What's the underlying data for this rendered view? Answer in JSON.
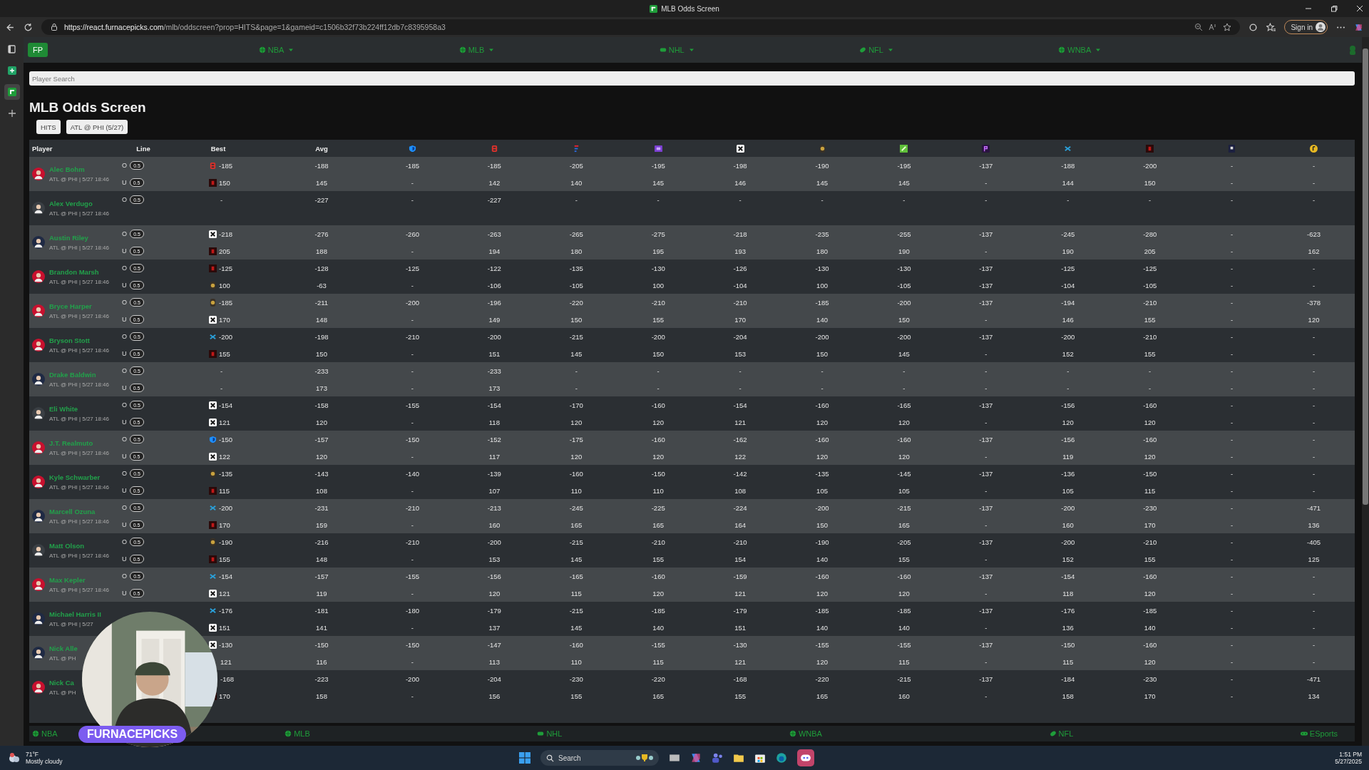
{
  "browser": {
    "tab_title": "MLB Odds Screen",
    "url_host": "https://react.furnacepicks.com",
    "url_path": "/mlb/oddscreen?prop=HITS&page=1&gameid=c1506b32f73b224ff12db7c8395958a3",
    "sign_in": "Sign in"
  },
  "sidebar": {
    "apps": [
      {
        "kind": "tabs",
        "selected": false
      },
      {
        "kind": "sheet",
        "selected": false
      },
      {
        "kind": "fp",
        "selected": true
      },
      {
        "kind": "add",
        "selected": false
      }
    ]
  },
  "nav": {
    "logo": "FP",
    "leagues": [
      {
        "label": "NBA",
        "kind": "ball"
      },
      {
        "label": "MLB",
        "kind": "ball"
      },
      {
        "label": "NHL",
        "kind": "puck"
      },
      {
        "label": "NFL",
        "kind": "football"
      },
      {
        "label": "WNBA",
        "kind": "ball"
      }
    ]
  },
  "search": {
    "placeholder": "Player Search"
  },
  "title": "MLB Odds Screen",
  "filters": [
    "HITS",
    "ATL @ PHI (5/27)"
  ],
  "table": {
    "columns": [
      "Player",
      "Line",
      "Best",
      "Avg"
    ],
    "books": [
      {
        "kind": "shield"
      },
      {
        "kind": "b"
      },
      {
        "kind": "f"
      },
      {
        "kind": "purple"
      },
      {
        "kind": "n"
      },
      {
        "kind": "lion"
      },
      {
        "kind": "green"
      },
      {
        "kind": "p"
      },
      {
        "kind": "x"
      },
      {
        "kind": "red"
      },
      {
        "kind": "pdark"
      },
      {
        "kind": "gold"
      }
    ],
    "rows": [
      {
        "name": "Alec Bohm",
        "game": "ATL @ PHI | 5/27 18:46",
        "color": "#c8102e",
        "lines": [
          {
            "side": "O",
            "line": "0.5",
            "best_icon": {
              "kind": "b"
            },
            "best": "-185",
            "avg": "-188",
            "books": [
              "-185",
              "-185",
              "-205",
              "-195",
              "-198",
              "-190",
              "-195",
              "-137",
              "-188",
              "-200",
              "-",
              "-"
            ]
          },
          {
            "side": "U",
            "line": "0.5",
            "best_icon": {
              "kind": "red"
            },
            "best": "150",
            "avg": "145",
            "books": [
              "-",
              "142",
              "140",
              "145",
              "146",
              "145",
              "145",
              "-",
              "144",
              "150",
              "-",
              "-"
            ]
          }
        ]
      },
      {
        "name": "Alex Verdugo",
        "game": "ATL @ PHI | 5/27 18:46",
        "color": "#3a3f44",
        "lines": [
          {
            "side": "O",
            "line": "0.5",
            "best": "-",
            "avg": "-227",
            "books": [
              "-",
              "-227",
              "-",
              "-",
              "-",
              "-",
              "-",
              "-",
              "-",
              "-",
              "-",
              "-"
            ]
          }
        ]
      },
      {
        "name": "Austin Riley",
        "game": "ATL @ PHI | 5/27 18:46",
        "color": "#1f2a44",
        "lines": [
          {
            "side": "O",
            "line": "0.5",
            "best_icon": {
              "kind": "n"
            },
            "best": "-218",
            "avg": "-276",
            "books": [
              "-260",
              "-263",
              "-265",
              "-275",
              "-218",
              "-235",
              "-255",
              "-137",
              "-245",
              "-280",
              "-",
              "-623"
            ]
          },
          {
            "side": "U",
            "line": "0.5",
            "best_icon": {
              "kind": "red"
            },
            "best": "205",
            "avg": "188",
            "books": [
              "-",
              "194",
              "180",
              "195",
              "193",
              "180",
              "190",
              "-",
              "190",
              "205",
              "-",
              "162"
            ]
          }
        ]
      },
      {
        "name": "Brandon Marsh",
        "game": "ATL @ PHI | 5/27 18:46",
        "color": "#c8102e",
        "lines": [
          {
            "side": "O",
            "line": "0.5",
            "best_icon": {
              "kind": "red"
            },
            "best": "-125",
            "avg": "-128",
            "books": [
              "-125",
              "-122",
              "-135",
              "-130",
              "-126",
              "-130",
              "-130",
              "-137",
              "-125",
              "-125",
              "-",
              "-"
            ]
          },
          {
            "side": "U",
            "line": "0.5",
            "best_icon": {
              "kind": "lion"
            },
            "best": "100",
            "avg": "-63",
            "books": [
              "-",
              "-106",
              "-105",
              "100",
              "-104",
              "100",
              "-105",
              "-137",
              "-104",
              "-105",
              "-",
              "-"
            ]
          }
        ]
      },
      {
        "name": "Bryce Harper",
        "game": "ATL @ PHI | 5/27 18:46",
        "color": "#c8102e",
        "lines": [
          {
            "side": "O",
            "line": "0.5",
            "best_icon": {
              "kind": "lion"
            },
            "best": "-185",
            "avg": "-211",
            "books": [
              "-200",
              "-196",
              "-220",
              "-210",
              "-210",
              "-185",
              "-200",
              "-137",
              "-194",
              "-210",
              "-",
              "-378"
            ]
          },
          {
            "side": "U",
            "line": "0.5",
            "best_icon": {
              "kind": "n"
            },
            "best": "170",
            "avg": "148",
            "books": [
              "-",
              "149",
              "150",
              "155",
              "170",
              "140",
              "150",
              "-",
              "146",
              "155",
              "-",
              "120"
            ]
          }
        ]
      },
      {
        "name": "Bryson Stott",
        "game": "ATL @ PHI | 5/27 18:46",
        "color": "#c8102e",
        "lines": [
          {
            "side": "O",
            "line": "0.5",
            "best_icon": {
              "kind": "x"
            },
            "best": "-200",
            "avg": "-198",
            "books": [
              "-210",
              "-200",
              "-215",
              "-200",
              "-204",
              "-200",
              "-200",
              "-137",
              "-200",
              "-210",
              "-",
              "-"
            ]
          },
          {
            "side": "U",
            "line": "0.5",
            "best_icon": {
              "kind": "red"
            },
            "best": "155",
            "avg": "150",
            "books": [
              "-",
              "151",
              "145",
              "150",
              "153",
              "150",
              "145",
              "-",
              "152",
              "155",
              "-",
              "-"
            ]
          }
        ]
      },
      {
        "name": "Drake Baldwin",
        "game": "ATL @ PHI | 5/27 18:46",
        "color": "#1f2a44",
        "lines": [
          {
            "side": "O",
            "line": "0.5",
            "best": "-",
            "avg": "-233",
            "books": [
              "-",
              "-233",
              "-",
              "-",
              "-",
              "-",
              "-",
              "-",
              "-",
              "-",
              "-",
              "-"
            ]
          },
          {
            "side": "U",
            "line": "0.5",
            "best": "-",
            "avg": "173",
            "books": [
              "-",
              "173",
              "-",
              "-",
              "-",
              "-",
              "-",
              "-",
              "-",
              "-",
              "-",
              "-"
            ]
          }
        ]
      },
      {
        "name": "Eli White",
        "game": "ATL @ PHI | 5/27 18:46",
        "color": "#3a3f44",
        "lines": [
          {
            "side": "O",
            "line": "0.5",
            "best_icon": {
              "kind": "n"
            },
            "best": "-154",
            "avg": "-158",
            "books": [
              "-155",
              "-154",
              "-170",
              "-160",
              "-154",
              "-160",
              "-165",
              "-137",
              "-156",
              "-160",
              "-",
              "-"
            ]
          },
          {
            "side": "U",
            "line": "0.5",
            "best_icon": {
              "kind": "n"
            },
            "best": "121",
            "avg": "120",
            "books": [
              "-",
              "118",
              "120",
              "120",
              "121",
              "120",
              "120",
              "-",
              "120",
              "120",
              "-",
              "-"
            ]
          }
        ]
      },
      {
        "name": "J.T. Realmuto",
        "game": "ATL @ PHI | 5/27 18:46",
        "color": "#c8102e",
        "lines": [
          {
            "side": "O",
            "line": "0.5",
            "best_icon": {
              "kind": "shield"
            },
            "best": "-150",
            "avg": "-157",
            "books": [
              "-150",
              "-152",
              "-175",
              "-160",
              "-162",
              "-160",
              "-160",
              "-137",
              "-156",
              "-160",
              "-",
              "-"
            ]
          },
          {
            "side": "U",
            "line": "0.5",
            "best_icon": {
              "kind": "n"
            },
            "best": "122",
            "avg": "120",
            "books": [
              "-",
              "117",
              "120",
              "120",
              "122",
              "120",
              "120",
              "-",
              "119",
              "120",
              "-",
              "-"
            ]
          }
        ]
      },
      {
        "name": "Kyle Schwarber",
        "game": "ATL @ PHI | 5/27 18:46",
        "color": "#c8102e",
        "lines": [
          {
            "side": "O",
            "line": "0.5",
            "best_icon": {
              "kind": "lion"
            },
            "best": "-135",
            "avg": "-143",
            "books": [
              "-140",
              "-139",
              "-160",
              "-150",
              "-142",
              "-135",
              "-145",
              "-137",
              "-136",
              "-150",
              "-",
              "-"
            ]
          },
          {
            "side": "U",
            "line": "0.5",
            "best_icon": {
              "kind": "red"
            },
            "best": "115",
            "avg": "108",
            "books": [
              "-",
              "107",
              "110",
              "110",
              "108",
              "105",
              "105",
              "-",
              "105",
              "115",
              "-",
              "-"
            ]
          }
        ]
      },
      {
        "name": "Marcell Ozuna",
        "game": "ATL @ PHI | 5/27 18:46",
        "color": "#1f2a44",
        "lines": [
          {
            "side": "O",
            "line": "0.5",
            "best_icon": {
              "kind": "x"
            },
            "best": "-200",
            "avg": "-231",
            "books": [
              "-210",
              "-213",
              "-245",
              "-225",
              "-224",
              "-200",
              "-215",
              "-137",
              "-200",
              "-230",
              "-",
              "-471"
            ]
          },
          {
            "side": "U",
            "line": "0.5",
            "best_icon": {
              "kind": "red"
            },
            "best": "170",
            "avg": "159",
            "books": [
              "-",
              "160",
              "165",
              "165",
              "164",
              "150",
              "165",
              "-",
              "160",
              "170",
              "-",
              "136"
            ]
          }
        ]
      },
      {
        "name": "Matt Olson",
        "game": "ATL @ PHI | 5/27 18:46",
        "color": "#3a3f44",
        "lines": [
          {
            "side": "O",
            "line": "0.5",
            "best_icon": {
              "kind": "lion"
            },
            "best": "-190",
            "avg": "-216",
            "books": [
              "-210",
              "-200",
              "-215",
              "-210",
              "-210",
              "-190",
              "-205",
              "-137",
              "-200",
              "-210",
              "-",
              "-405"
            ]
          },
          {
            "side": "U",
            "line": "0.5",
            "best_icon": {
              "kind": "red"
            },
            "best": "155",
            "avg": "148",
            "books": [
              "-",
              "153",
              "145",
              "155",
              "154",
              "140",
              "155",
              "-",
              "152",
              "155",
              "-",
              "125"
            ]
          }
        ]
      },
      {
        "name": "Max Kepler",
        "game": "ATL @ PHI | 5/27 18:46",
        "color": "#c8102e",
        "lines": [
          {
            "side": "O",
            "line": "0.5",
            "best_icon": {
              "kind": "x"
            },
            "best": "-154",
            "avg": "-157",
            "books": [
              "-155",
              "-156",
              "-165",
              "-160",
              "-159",
              "-160",
              "-160",
              "-137",
              "-154",
              "-160",
              "-",
              "-"
            ]
          },
          {
            "side": "U",
            "line": "0.5",
            "best_icon": {
              "kind": "n"
            },
            "best": "121",
            "avg": "119",
            "books": [
              "-",
              "120",
              "115",
              "120",
              "121",
              "120",
              "120",
              "-",
              "118",
              "120",
              "-",
              "-"
            ]
          }
        ]
      },
      {
        "name": "Michael Harris II",
        "game": "ATL @ PHI | 5/27",
        "color": "#1f2a44",
        "lines": [
          {
            "best_icon": {
              "kind": "x"
            },
            "best": "-176",
            "avg": "-181",
            "books": [
              "-180",
              "-179",
              "-215",
              "-185",
              "-179",
              "-185",
              "-185",
              "-137",
              "-176",
              "-185",
              "-",
              "-"
            ]
          },
          {
            "best_icon": {
              "kind": "n"
            },
            "best": "151",
            "avg": "141",
            "books": [
              "-",
              "137",
              "145",
              "140",
              "151",
              "140",
              "140",
              "-",
              "136",
              "140",
              "-",
              "-"
            ]
          }
        ]
      },
      {
        "name": "Nick Alle",
        "game": "ATL @ PH",
        "color": "#1f2a44",
        "lines": [
          {
            "best_icon": {
              "kind": "n"
            },
            "best": "-130",
            "avg": "-150",
            "books": [
              "-150",
              "-147",
              "-160",
              "-155",
              "-130",
              "-155",
              "-155",
              "-137",
              "-150",
              "-160",
              "-",
              "-"
            ]
          },
          {
            "best": "121",
            "avg": "116",
            "books": [
              "-",
              "113",
              "110",
              "115",
              "121",
              "120",
              "115",
              "-",
              "115",
              "120",
              "-",
              "-"
            ]
          }
        ]
      },
      {
        "name": "Nick Ca",
        "game": "ATL @ PH",
        "color": "#c8102e",
        "lines": [
          {
            "best": "-168",
            "avg": "-223",
            "books": [
              "-200",
              "-204",
              "-230",
              "-220",
              "-168",
              "-220",
              "-215",
              "-137",
              "-184",
              "-230",
              "-",
              "-471"
            ]
          },
          {
            "best_icon": {
              "kind": "red"
            },
            "best": "170",
            "avg": "158",
            "books": [
              "-",
              "156",
              "155",
              "165",
              "155",
              "165",
              "160",
              "-",
              "158",
              "170",
              "-",
              "134"
            ]
          }
        ]
      }
    ]
  },
  "footer": [
    {
      "label": "NBA",
      "kind": "ball"
    },
    {
      "label": "MLB",
      "kind": "ball"
    },
    {
      "label": "NHL",
      "kind": "puck"
    },
    {
      "label": "WNBA",
      "kind": "ball"
    },
    {
      "label": "NFL",
      "kind": "football"
    },
    {
      "label": "ESports",
      "kind": "pad"
    }
  ],
  "overlay": {
    "label": "FURNACEPICKS"
  },
  "taskbar": {
    "temp": "71°F",
    "weather": "Mostly cloudy",
    "search": "Search",
    "time": "1:51 PM",
    "date": "5/27/2025"
  }
}
